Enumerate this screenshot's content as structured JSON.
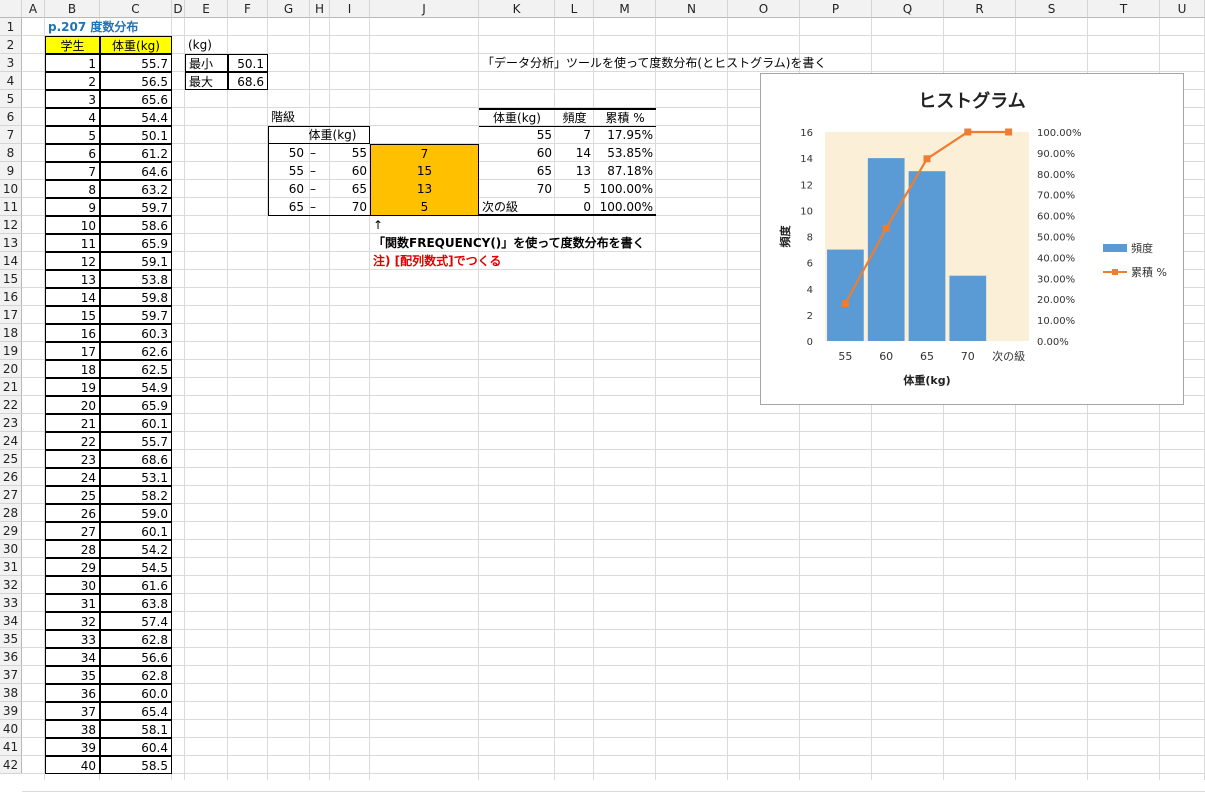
{
  "columns": [
    "A",
    "B",
    "C",
    "D",
    "E",
    "F",
    "G",
    "H",
    "I",
    "J",
    "K",
    "L",
    "M",
    "N",
    "O",
    "P",
    "Q",
    "R",
    "S",
    "T",
    "U"
  ],
  "rows": [
    "1",
    "2",
    "3",
    "4",
    "5",
    "6",
    "7",
    "8",
    "9",
    "10",
    "11",
    "12",
    "13",
    "14",
    "15",
    "16",
    "17",
    "18",
    "19",
    "20",
    "21",
    "22",
    "23",
    "24",
    "25",
    "26",
    "27",
    "28",
    "29",
    "30",
    "31",
    "32",
    "33",
    "34",
    "35",
    "36",
    "37",
    "38",
    "39",
    "40",
    "41",
    "42"
  ],
  "title": "p.207 度数分布",
  "header": {
    "student": "学生",
    "weight": "体重(kg)"
  },
  "students": [
    "1",
    "2",
    "3",
    "4",
    "5",
    "6",
    "7",
    "8",
    "9",
    "10",
    "11",
    "12",
    "13",
    "14",
    "15",
    "16",
    "17",
    "18",
    "19",
    "20",
    "21",
    "22",
    "23",
    "24",
    "25",
    "26",
    "27",
    "28",
    "29",
    "30",
    "31",
    "32",
    "33",
    "34",
    "35",
    "36",
    "37",
    "38",
    "39",
    "40"
  ],
  "weights": [
    "55.7",
    "56.5",
    "65.6",
    "54.4",
    "50.1",
    "61.2",
    "64.6",
    "63.2",
    "59.7",
    "58.6",
    "65.9",
    "59.1",
    "53.8",
    "59.8",
    "59.7",
    "60.3",
    "62.6",
    "62.5",
    "54.9",
    "65.9",
    "60.1",
    "55.7",
    "68.6",
    "53.1",
    "58.2",
    "59.0",
    "60.1",
    "54.2",
    "54.5",
    "61.6",
    "63.8",
    "57.4",
    "62.8",
    "56.6",
    "62.8",
    "60.0",
    "65.4",
    "58.1",
    "60.4",
    "58.5"
  ],
  "minmax": {
    "unit": "(kg)",
    "min_label": "最小",
    "min_value": "50.1",
    "max_label": "最大",
    "max_value": "68.6"
  },
  "classes": {
    "label": "階級",
    "sub": "体重(kg)",
    "rows": [
      {
        "from": "50",
        "dash": "–",
        "to": "55",
        "freq": "7"
      },
      {
        "from": "55",
        "dash": "–",
        "to": "60",
        "freq": "15"
      },
      {
        "from": "60",
        "dash": "–",
        "to": "65",
        "freq": "13"
      },
      {
        "from": "65",
        "dash": "–",
        "to": "70",
        "freq": "5"
      }
    ]
  },
  "notes": {
    "arrow": "↑",
    "line1": "「関数FREQUENCY()」を使って度数分布を書く",
    "line2": "注) [配列数式]でつくる",
    "tool": "「データ分析」ツールを使って度数分布(とヒストグラム)を書く"
  },
  "analysis": {
    "headers": [
      "体重(kg)",
      "頻度",
      "累積 %"
    ],
    "rows": [
      [
        "55",
        "7",
        "17.95%"
      ],
      [
        "60",
        "14",
        "53.85%"
      ],
      [
        "65",
        "13",
        "87.18%"
      ],
      [
        "70",
        "5",
        "100.00%"
      ],
      [
        "次の級",
        "0",
        "100.00%"
      ]
    ]
  },
  "chart_data": {
    "type": "bar",
    "title": "ヒストグラム",
    "xlabel": "体重(kg)",
    "ylabel": "頻度",
    "categories": [
      "55",
      "60",
      "65",
      "70",
      "次の級"
    ],
    "series": [
      {
        "name": "頻度",
        "type": "bar",
        "values": [
          7,
          14,
          13,
          5,
          0
        ],
        "color": "#5b9bd5"
      },
      {
        "name": "累積 %",
        "type": "line",
        "values": [
          17.95,
          53.85,
          87.18,
          100.0,
          100.0
        ],
        "color": "#ed7d31"
      }
    ],
    "ylim": [
      0,
      16
    ],
    "y_ticks": [
      "0",
      "2",
      "4",
      "6",
      "8",
      "10",
      "12",
      "14",
      "16"
    ],
    "y2lim": [
      0,
      100
    ],
    "y2_ticks": [
      "0.00%",
      "10.00%",
      "20.00%",
      "30.00%",
      "40.00%",
      "50.00%",
      "60.00%",
      "70.00%",
      "80.00%",
      "90.00%",
      "100.00%"
    ],
    "legend": "right",
    "plot_background": "#fbefd8"
  }
}
